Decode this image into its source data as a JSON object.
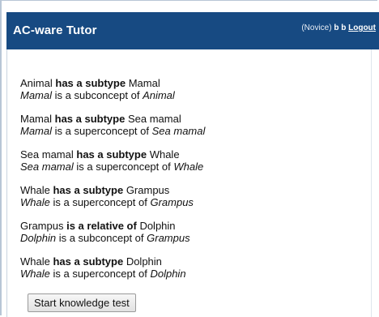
{
  "app": {
    "title": "AC-ware Tutor"
  },
  "user": {
    "level": "(Novice)",
    "name": "b b",
    "logout_label": "Logout"
  },
  "statements": [
    {
      "line1": {
        "a": "Animal",
        "rel": "has a subtype",
        "b": "Mamal"
      },
      "line2": {
        "a": "Mamal",
        "rel": "is a subconcept of",
        "b": "Animal"
      }
    },
    {
      "line1": {
        "a": "Mamal",
        "rel": "has a subtype",
        "b": "Sea mamal"
      },
      "line2": {
        "a": "Mamal",
        "rel": "is a superconcept of",
        "b": "Sea mamal"
      }
    },
    {
      "line1": {
        "a": "Sea mamal",
        "rel": "has a subtype",
        "b": "Whale"
      },
      "line2": {
        "a": "Sea mamal",
        "rel": "is a superconcept of",
        "b": "Whale"
      }
    },
    {
      "line1": {
        "a": "Whale",
        "rel": "has a subtype",
        "b": "Grampus"
      },
      "line2": {
        "a": "Whale",
        "rel": "is a superconcept of",
        "b": "Grampus"
      }
    },
    {
      "line1": {
        "a": "Grampus",
        "rel": "is a relative of",
        "b": "Dolphin"
      },
      "line2": {
        "a": "Dolphin",
        "rel": "is a subconcept of",
        "b": "Grampus"
      }
    },
    {
      "line1": {
        "a": "Whale",
        "rel": "has a subtype",
        "b": "Dolphin"
      },
      "line2": {
        "a": "Whale",
        "rel": "is a superconcept of",
        "b": "Dolphin"
      }
    }
  ],
  "actions": {
    "start_test_label": "Start knowledge test"
  },
  "colors": {
    "header_bg": "#174a82",
    "header_text": "#ffffff"
  }
}
